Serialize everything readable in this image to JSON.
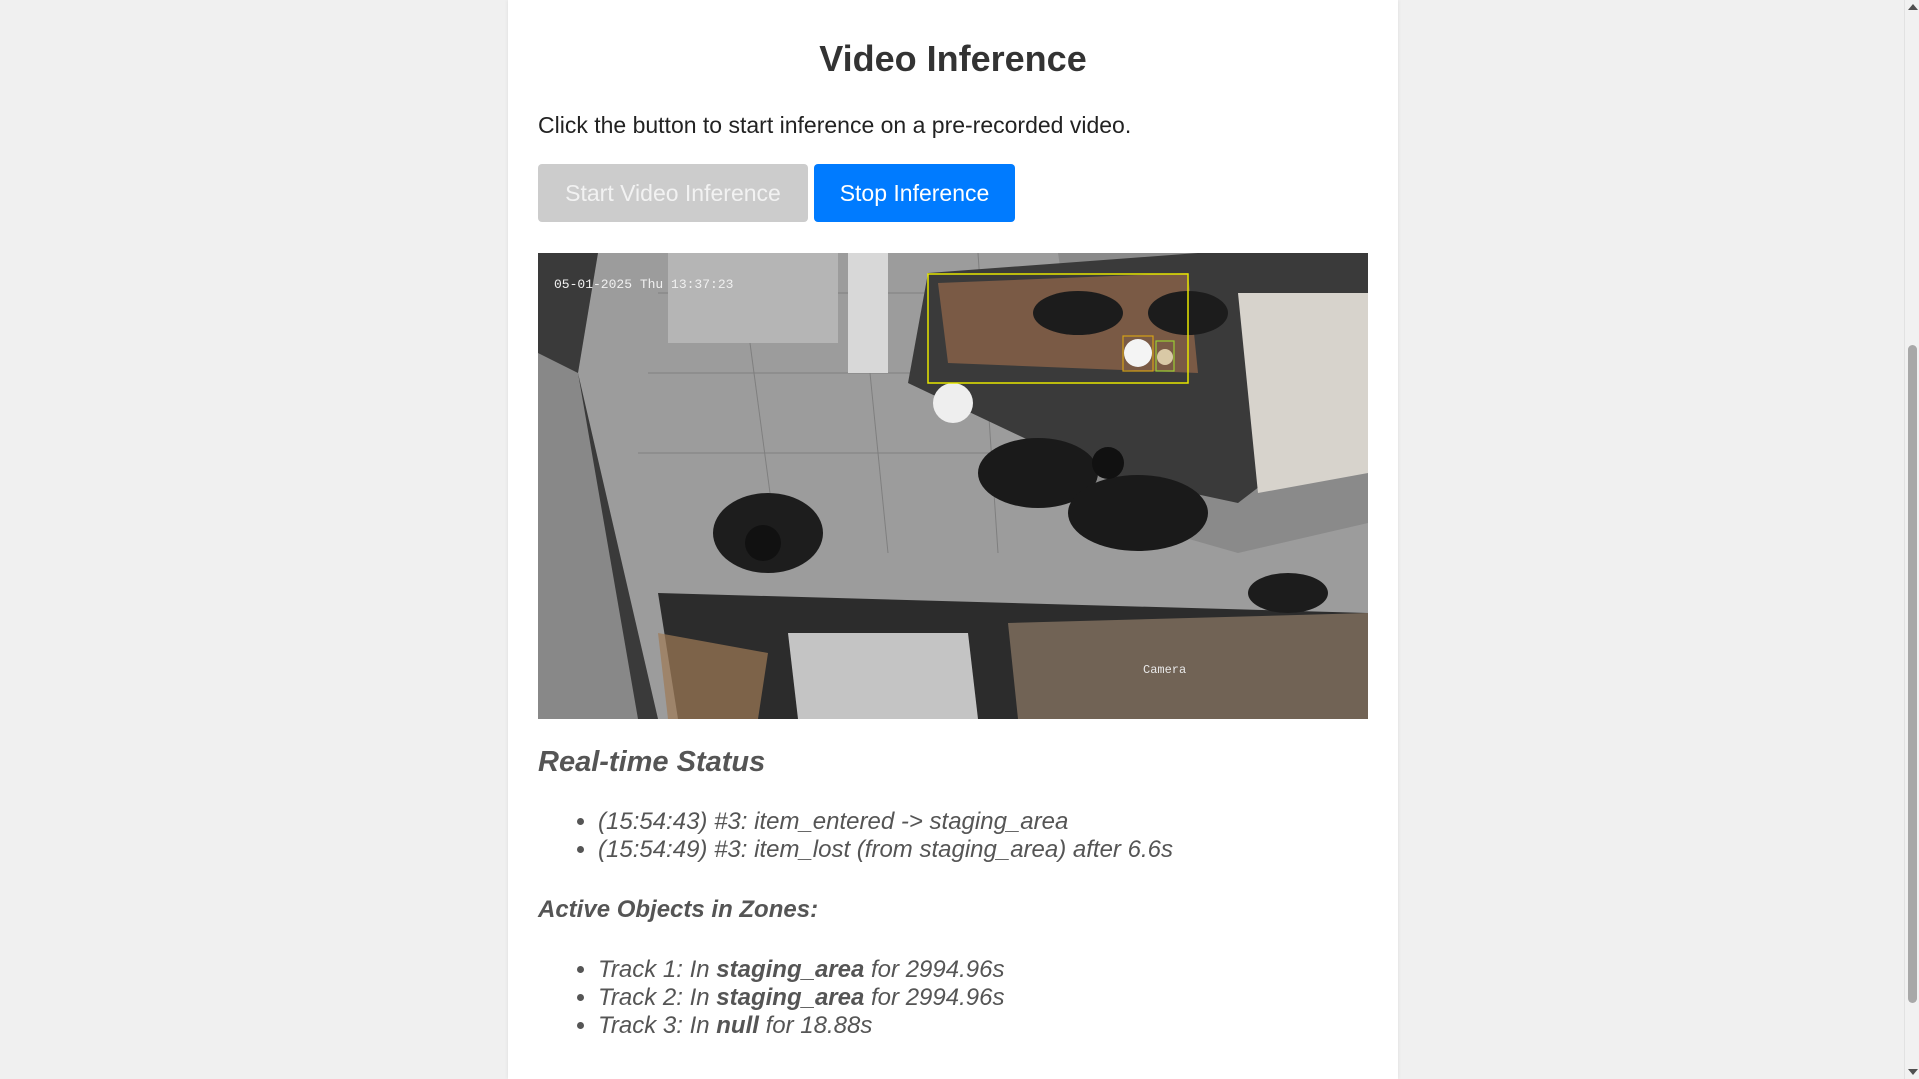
{
  "page": {
    "title": "Video Inference",
    "intro": "Click the button to start inference on a pre-recorded video."
  },
  "buttons": {
    "start_label": "Start Video Inference",
    "start_disabled": true,
    "stop_label": "Stop Inference"
  },
  "video": {
    "timestamp_overlay": "05-01-2025 Thu 13:37:23",
    "camera_label": "Camera"
  },
  "status": {
    "title": "Real-time Status",
    "events": [
      "(15:54:43) #3: item_entered -> staging_area",
      "(15:54:49) #3: item_lost (from staging_area) after 6.6s"
    ]
  },
  "zones": {
    "title": "Active Objects in Zones:",
    "tracks": [
      {
        "prefix": "Track 1: In ",
        "zone": "staging_area",
        "suffix": " for 2994.96s"
      },
      {
        "prefix": "Track 2: In ",
        "zone": "staging_area",
        "suffix": " for 2994.96s"
      },
      {
        "prefix": "Track 3: In ",
        "zone": "null",
        "suffix": " for 18.88s"
      }
    ]
  },
  "colors": {
    "primary": "#007bff",
    "disabled": "#cccccc",
    "detection_box": "#e6e600"
  }
}
